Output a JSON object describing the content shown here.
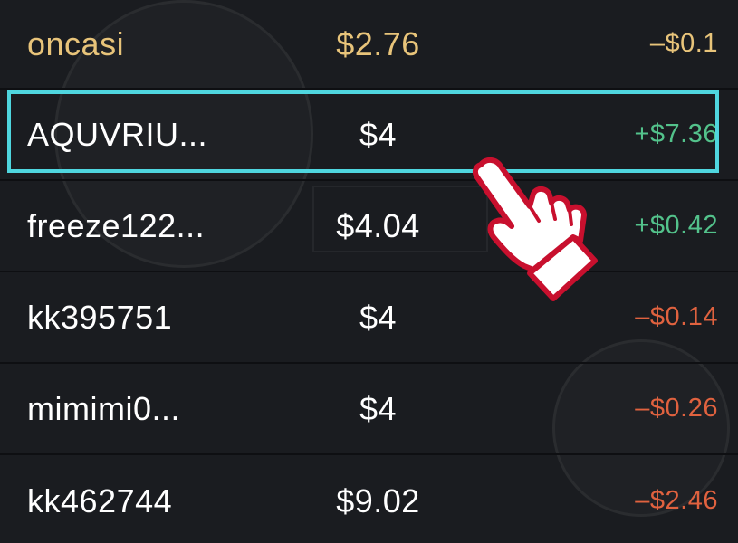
{
  "colors": {
    "background": "#1a1c20",
    "highlight_border": "#4fd6df",
    "gold_text": "#e8c47a",
    "positive": "#53c28b",
    "negative": "#e0623f",
    "hand_outline": "#c8102e"
  },
  "rows": [
    {
      "player": "oncasi",
      "bet": "$2.76",
      "profit": "–$0.1"
    },
    {
      "player": "AQUVRIU...",
      "bet": "$4",
      "profit": "+$7.36"
    },
    {
      "player": "freeze122...",
      "bet": "$4.04",
      "profit": "+$0.42"
    },
    {
      "player": "kk395751",
      "bet": "$4",
      "profit": "–$0.14"
    },
    {
      "player": "mimimi0...",
      "bet": "$4",
      "profit": "–$0.26"
    },
    {
      "player": "kk462744",
      "bet": "$9.02",
      "profit": "–$2.46"
    }
  ],
  "pointer": {
    "icon": "pointing-hand-icon"
  }
}
